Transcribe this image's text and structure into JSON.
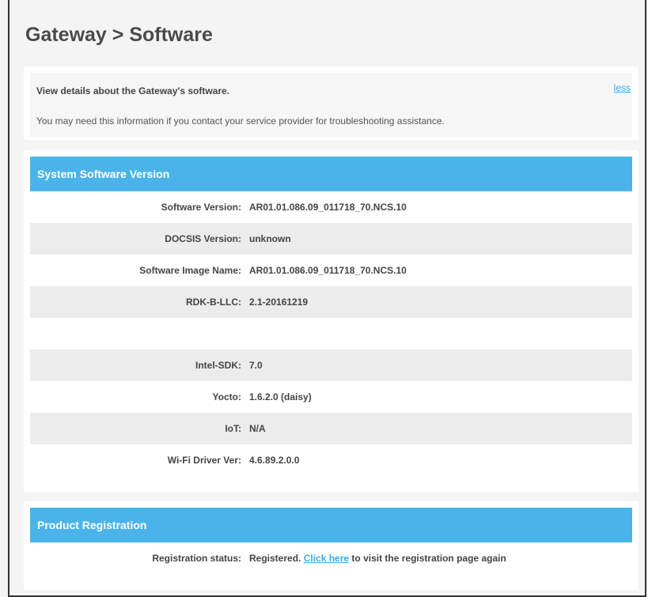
{
  "page": {
    "title": "Gateway > Software"
  },
  "info": {
    "lead": "View details about the Gateway's software.",
    "more": "You may need this information if you contact your service provider for troubleshooting assistance.",
    "toggle_label": "less"
  },
  "system": {
    "header": "System Software Version",
    "rows": [
      {
        "label": "Software Version:",
        "value": "AR01.01.086.09_011718_70.NCS.10"
      },
      {
        "label": "DOCSIS Version:",
        "value": "unknown"
      },
      {
        "label": "Software Image Name:",
        "value": "AR01.01.086.09_011718_70.NCS.10"
      },
      {
        "label": "RDK-B-LLC:",
        "value": "2.1-20161219"
      },
      {
        "label": "",
        "value": ""
      },
      {
        "label": "Intel-SDK:",
        "value": "7.0"
      },
      {
        "label": "Yocto:",
        "value": "1.6.2.0 (daisy)"
      },
      {
        "label": "IoT:",
        "value": "N/A"
      },
      {
        "label": "Wi-Fi Driver Ver:",
        "value": "4.6.89.2.0.0"
      }
    ]
  },
  "registration": {
    "header": "Product Registration",
    "label": "Registration status:",
    "status": "Registered.",
    "link_text": "Click here",
    "suffix": " to visit the registration page again"
  }
}
